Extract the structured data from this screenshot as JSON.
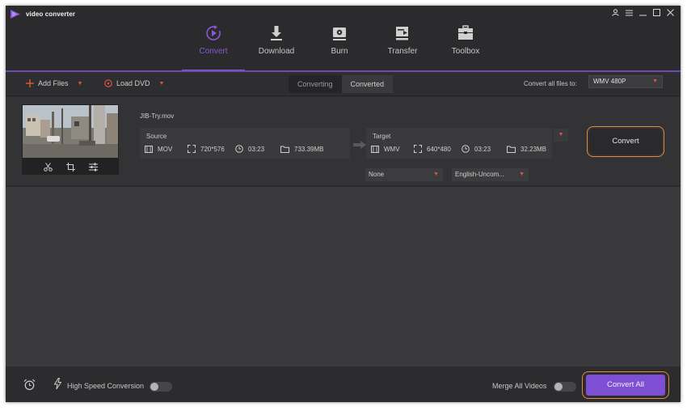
{
  "app": {
    "title": "video converter",
    "logo_icon": "play-logo-icon",
    "accent": "#8a57d6"
  },
  "window_controls": [
    "user-icon",
    "menu-icon",
    "minimize-icon",
    "maximize-icon",
    "close-icon"
  ],
  "nav": {
    "items": [
      {
        "label": "Convert",
        "icon": "convert-icon",
        "active": true
      },
      {
        "label": "Download",
        "icon": "download-icon",
        "active": false
      },
      {
        "label": "Burn",
        "icon": "burn-icon",
        "active": false
      },
      {
        "label": "Transfer",
        "icon": "transfer-icon",
        "active": false
      },
      {
        "label": "Toolbox",
        "icon": "toolbox-icon",
        "active": false
      }
    ]
  },
  "toolbar": {
    "add_files": "Add Files",
    "load_dvd": "Load DVD",
    "tab_converting": "Converting",
    "tab_converted": "Converted",
    "convert_all_label": "Convert all files to:",
    "convert_all_format": "WMV 480P"
  },
  "file": {
    "name": "JIB-Try.mov",
    "source": {
      "title": "Source",
      "format": "MOV",
      "resolution": "720*576",
      "duration": "03:23",
      "size": "733.39MB"
    },
    "target": {
      "title": "Target",
      "format": "WMV",
      "resolution": "640*480",
      "duration": "03:23",
      "size": "32.23MB"
    },
    "subtitle_select": "None",
    "audio_select": "English-Uncom...",
    "convert_button": "Convert"
  },
  "bottom": {
    "high_speed_label": "High Speed Conversion",
    "high_speed_on": false,
    "merge_label": "Merge All Videos",
    "merge_on": false,
    "convert_all_button": "Convert All"
  }
}
